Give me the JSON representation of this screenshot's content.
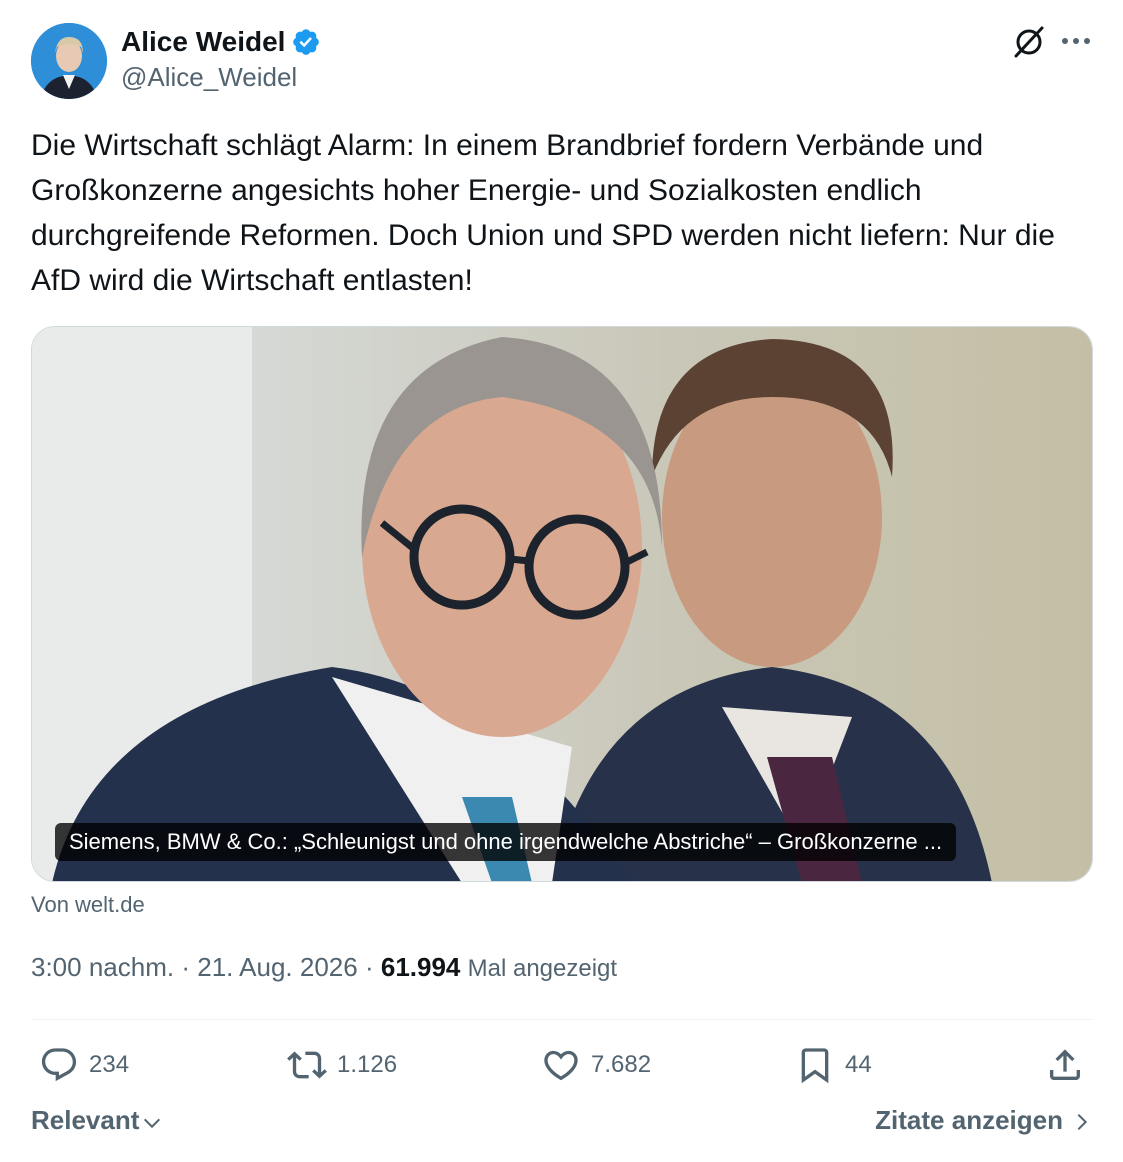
{
  "author": {
    "display_name": "Alice Weidel",
    "handle": "@Alice_Weidel",
    "verified": true,
    "verified_color": "#1d9bf0"
  },
  "header_icons": {
    "grok": "grok-icon",
    "more": "more-icon"
  },
  "tweet": {
    "text": "Die Wirtschaft schlägt Alarm: In einem Brandbrief fordern Verbände und Großkonzerne angesichts hoher Energie- und Sozialkosten endlich durchgreifende Reformen. Doch Union und SPD werden nicht liefern: Nur die AfD wird die Wirtschaft entlasten!"
  },
  "link_card": {
    "caption": "Siemens, BMW & Co.: „Schleunigst und ohne irgendwelche Abstriche“ – Großkonzerne ...",
    "source": "Von welt.de"
  },
  "meta": {
    "time": "3:00 nachm.",
    "separator": "·",
    "date": "21. Aug. 2026",
    "views_count": "61.994",
    "views_label": "Mal angezeigt"
  },
  "actions": {
    "replies": "234",
    "reposts": "1.126",
    "likes": "7.682",
    "bookmarks": "44"
  },
  "footer": {
    "sort_label": "Relevant",
    "quotes_label": "Zitate anzeigen"
  },
  "colors": {
    "text_primary": "#0f1419",
    "text_secondary": "#536471",
    "accent": "#1d9bf0",
    "border": "#cfd9de"
  }
}
